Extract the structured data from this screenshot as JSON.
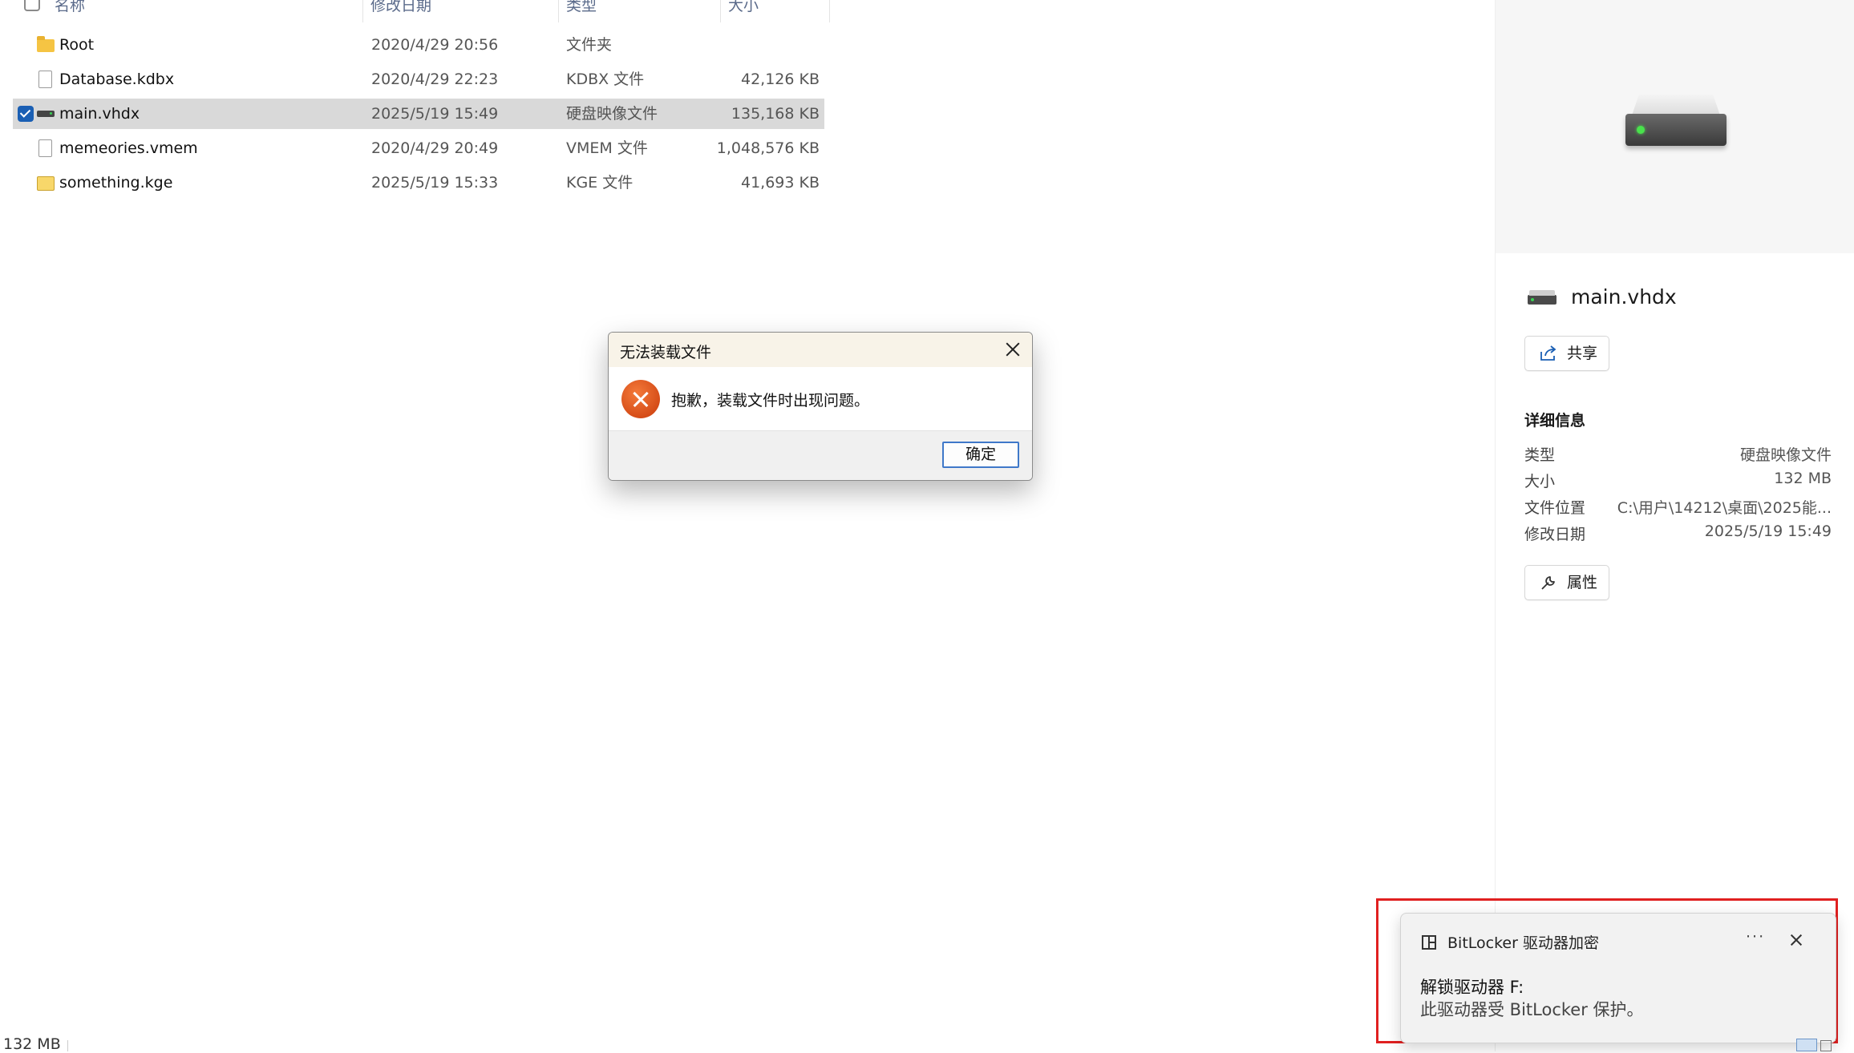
{
  "file_list": {
    "columns": {
      "name": "名称",
      "date": "修改日期",
      "type": "类型",
      "size": "大小"
    },
    "rows": [
      {
        "name": "Root",
        "date": "2020/4/29 20:56",
        "type": "文件夹",
        "size": "",
        "icon": "folder-icon"
      },
      {
        "name": "Database.kdbx",
        "date": "2020/4/29 22:23",
        "type": "KDBX 文件",
        "size": "42,126 KB",
        "icon": "file-icon"
      },
      {
        "name": "main.vhdx",
        "date": "2025/5/19 15:49",
        "type": "硬盘映像文件",
        "size": "135,168 KB",
        "icon": "disk-image-icon",
        "selected": true
      },
      {
        "name": "memeories.vmem",
        "date": "2020/4/29 20:49",
        "type": "VMEM 文件",
        "size": "1,048,576 KB",
        "icon": "file-icon"
      },
      {
        "name": "something.kge",
        "date": "2025/5/19 15:33",
        "type": "KGE 文件",
        "size": "41,693 KB",
        "icon": "kge-file-icon"
      }
    ]
  },
  "status_bar": {
    "selected_size": "132 MB"
  },
  "details_pane": {
    "file_name": "main.vhdx",
    "share_label": "共享",
    "details_heading": "详细信息",
    "properties": [
      {
        "label": "类型",
        "value": "硬盘映像文件"
      },
      {
        "label": "大小",
        "value": "132 MB"
      },
      {
        "label": "文件位置",
        "value": "C:\\用户\\14212\\桌面\\2025能..."
      },
      {
        "label": "修改日期",
        "value": "2025/5/19 15:49"
      }
    ],
    "properties_label": "属性"
  },
  "error_dialog": {
    "title": "无法装载文件",
    "message": "抱歉，装载文件时出现问题。",
    "ok_label": "确定"
  },
  "toast": {
    "app_name": "BitLocker 驱动器加密",
    "more_label": "···",
    "title": "解锁驱动器 F:",
    "body": "此驱动器受 BitLocker 保护。",
    "highlight_color": "#e02020"
  },
  "colors": {
    "selection": "#d9d9d9",
    "accent": "#1a5fb4",
    "error": "#d9480f"
  }
}
